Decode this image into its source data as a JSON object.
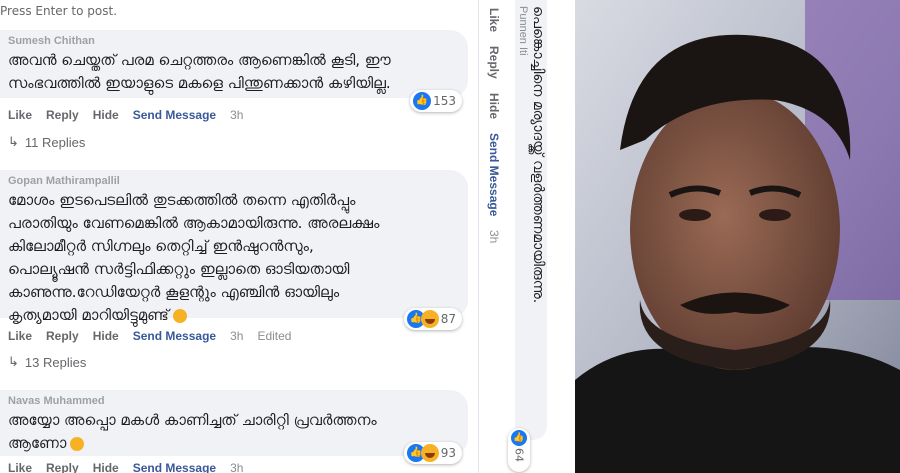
{
  "hint": "Press Enter to post.",
  "comments": [
    {
      "author": "Sumesh Chithan",
      "text_lines": [
        "അവൻ ചെയ്തത് പരമ ചെറ്റത്തരം ആണെങ്കിൽ കൂടി, ഈ",
        "സംഭവത്തിൽ ഇയാളുടെ മകളെ പിന്തുണക്കാൻ കഴിയില്ല."
      ],
      "reaction_count": "153",
      "actions": [
        "Like",
        "Reply",
        "Hide",
        "Send Message",
        "3h"
      ],
      "replies": "11 Replies"
    },
    {
      "author": "Gopan Mathirampallil",
      "text_lines": [
        "മോശം ഇടപെടലിൽ തുടക്കത്തിൽ തന്നെ എതിർപ്പും",
        "പരാതിയും വേണമെങ്കിൽ ആകാമായിരുന്നു. അരലക്ഷം",
        "കിലോമീറ്റർ സിഗ്നലും തെറ്റിച്ച് ഇൻഷുറൻസും,",
        "പൊല്യൂഷൻ സർട്ടിഫിക്കറ്റും ഇല്ലാതെ ഓടിയതായി",
        "കാണുന്നു.റേഡിയേറ്റർ കൂളന്റും എഞ്ചിൻ ഓയിലും",
        "കൃത്യമായി മാറിയിട്ടുമുണ്ട്"
      ],
      "reaction_count": "87",
      "actions": [
        "Like",
        "Reply",
        "Hide",
        "Send Message",
        "3h",
        "Edited"
      ],
      "replies": "13 Replies"
    },
    {
      "author": "Navas Muhammed",
      "text_lines": [
        "അയ്യോ അപ്പൊ മകൾ കാണിച്ചത് ചാരിറ്റി പ്രവർത്തനം",
        "ആണോ"
      ],
      "reaction_count": "93",
      "actions": [
        "Like",
        "Reply",
        "Hide",
        "Send Message",
        "3h"
      ]
    }
  ],
  "rotated_comment": {
    "author": "Punnen Iti",
    "text_lines": [
      "പെങ്കൊച്ചിനെ മര്യാദയ്ക്ക് വളർത്തണമായിരുന്നു."
    ],
    "reaction_count": "64",
    "actions": [
      "Like",
      "Reply",
      "Hide",
      "Send Message",
      "3h"
    ]
  },
  "icons": {
    "like": "like-icon",
    "haha": "haha-icon",
    "reply_arrow": "reply-arrow-icon"
  },
  "colors": {
    "bubble": "#f0f2f5",
    "link": "#385898",
    "like_blue": "#1877f2",
    "haha_yellow": "#f7b125"
  }
}
